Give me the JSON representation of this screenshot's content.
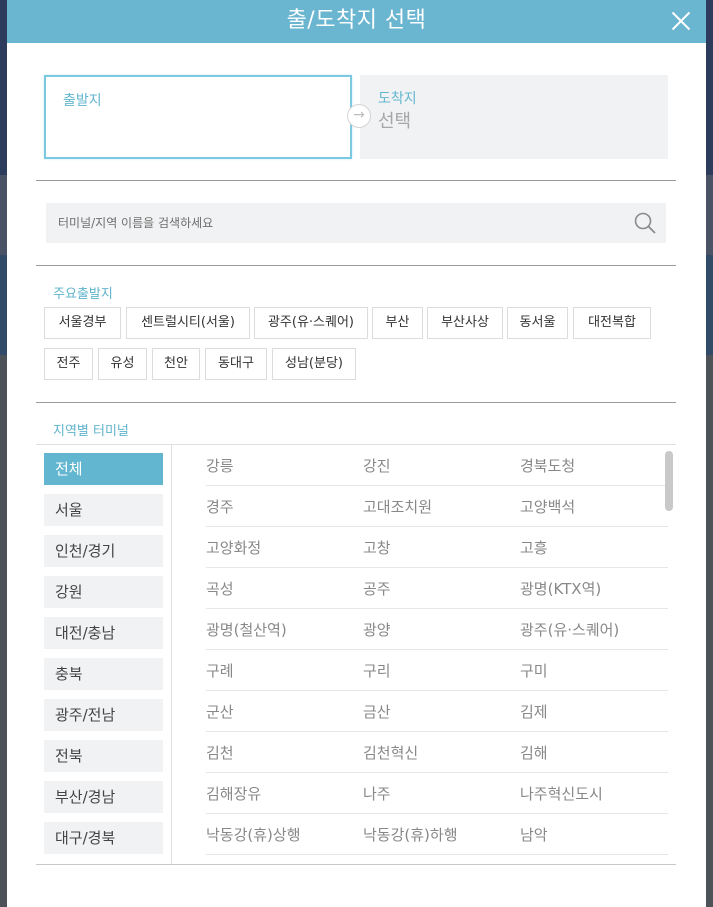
{
  "modal": {
    "title": "출/도착지 선택",
    "close_icon": "close-icon",
    "accent_color": "#6ab5cf"
  },
  "route": {
    "departure_label": "출발지",
    "departure_value": "",
    "arrival_label": "도착지",
    "arrival_value": "선택",
    "arrow_icon": "arrow-right-icon"
  },
  "search": {
    "placeholder": "터미널/지역 이름을 검색하세요",
    "icon": "search-icon"
  },
  "major": {
    "title": "주요출발지",
    "items": [
      "서울경부",
      "센트럴시티(서울)",
      "광주(유·스퀘어)",
      "부산",
      "부산사상",
      "동서울",
      "대전복합",
      "전주",
      "유성",
      "천안",
      "동대구",
      "성남(분당)"
    ]
  },
  "regions": {
    "title": "지역별 터미널",
    "items": [
      "전체",
      "서울",
      "인천/경기",
      "강원",
      "대전/충남",
      "충북",
      "광주/전남",
      "전북",
      "부산/경남",
      "대구/경북"
    ],
    "selected": "전체"
  },
  "terminals": {
    "rows": [
      [
        "강릉",
        "강진",
        "경북도청"
      ],
      [
        "경주",
        "고대조치원",
        "고양백석"
      ],
      [
        "고양화정",
        "고창",
        "고흥"
      ],
      [
        "곡성",
        "공주",
        "광명(KTX역)"
      ],
      [
        "광명(철산역)",
        "광양",
        "광주(유·스퀘어)"
      ],
      [
        "구례",
        "구리",
        "구미"
      ],
      [
        "군산",
        "금산",
        "김제"
      ],
      [
        "김천",
        "김천혁신",
        "김해"
      ],
      [
        "김해장유",
        "나주",
        "나주혁신도시"
      ],
      [
        "낙동강(휴)상행",
        "낙동강(휴)하행",
        "남악"
      ]
    ]
  }
}
